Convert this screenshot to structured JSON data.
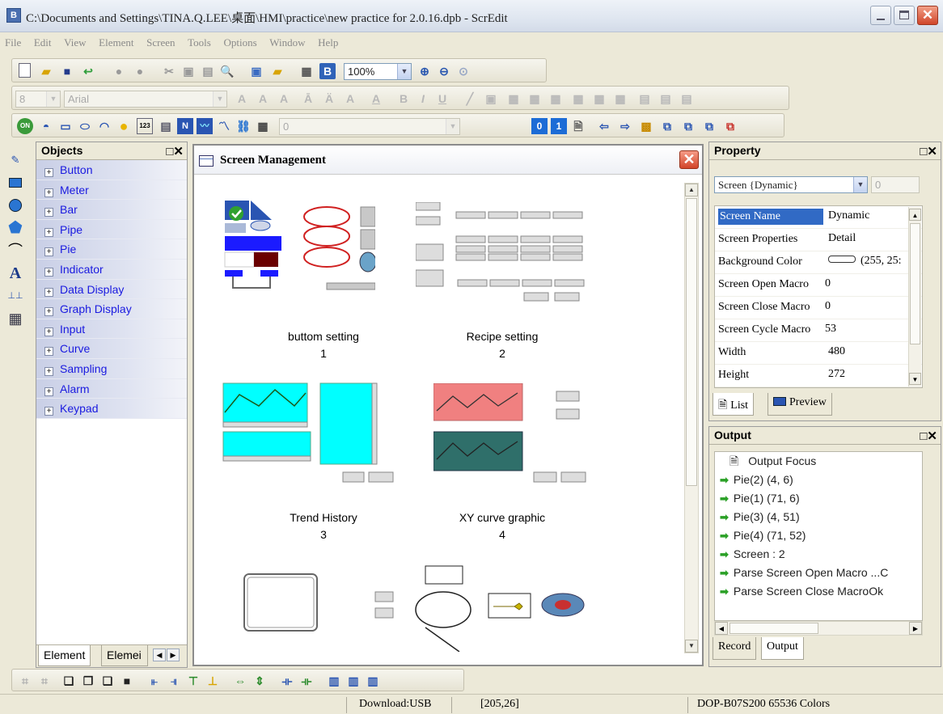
{
  "window": {
    "app_icon": "B",
    "title": "C:\\Documents and Settings\\TINA.Q.LEE\\桌面\\HMI\\practice\\new practice for 2.0.16.dpb - ScrEdit"
  },
  "menu": [
    "File",
    "Edit",
    "View",
    "Element",
    "Screen",
    "Tools",
    "Options",
    "Window",
    "Help"
  ],
  "toolbar": {
    "zoom": "100%",
    "font_size": "8",
    "font_name": "Arial",
    "state_combo": "0"
  },
  "objects_panel": {
    "title": "Objects",
    "items": [
      "Button",
      "Meter",
      "Bar",
      "Pipe",
      "Pie",
      "Indicator",
      "Data Display",
      "Graph Display",
      "Input",
      "Curve",
      "Sampling",
      "Alarm",
      "Keypad"
    ],
    "tabs": [
      "Element",
      "Elemei"
    ]
  },
  "screen_management": {
    "title": "Screen Management",
    "screens": [
      {
        "name": "buttom setting",
        "number": "1"
      },
      {
        "name": "Recipe setting",
        "number": "2"
      },
      {
        "name": "Trend History",
        "number": "3"
      },
      {
        "name": "XY curve graphic",
        "number": "4"
      }
    ]
  },
  "property_panel": {
    "title": "Property",
    "selector": "Screen {Dynamic}",
    "rows": [
      {
        "key": "Screen Name",
        "value": "Dynamic"
      },
      {
        "key": "Screen Properties",
        "value": "Detail"
      },
      {
        "key": "Background Color",
        "value": "(255, 25:"
      },
      {
        "key": "Screen Open Macro",
        "value": "0"
      },
      {
        "key": "Screen Close Macro",
        "value": "0"
      },
      {
        "key": "Screen Cycle Macro",
        "value": "53"
      },
      {
        "key": "Width",
        "value": "480"
      },
      {
        "key": "Height",
        "value": "272"
      }
    ],
    "tabs": [
      "List",
      "Preview"
    ]
  },
  "output_panel": {
    "title": "Output",
    "focus_label": "Output Focus",
    "lines": [
      "Pie(2) (4, 6)",
      "Pie(1) (71, 6)",
      "Pie(3) (4, 51)",
      "Pie(4) (71, 52)",
      "Screen : 2",
      "Parse Screen Open Macro ...C",
      "Parse Screen Close MacroOk"
    ],
    "tabs": [
      "Record",
      "Output"
    ]
  },
  "status": {
    "download": "Download:USB",
    "coords": "[205,26]",
    "device": "DOP-B07S200 65536 Colors"
  },
  "colors": {
    "selection": "#316ac5",
    "close_red": "#d24529",
    "trend_cyan": "#00ffff",
    "xy_salmon": "#f08080",
    "xy_teal": "#2f6f6a"
  }
}
